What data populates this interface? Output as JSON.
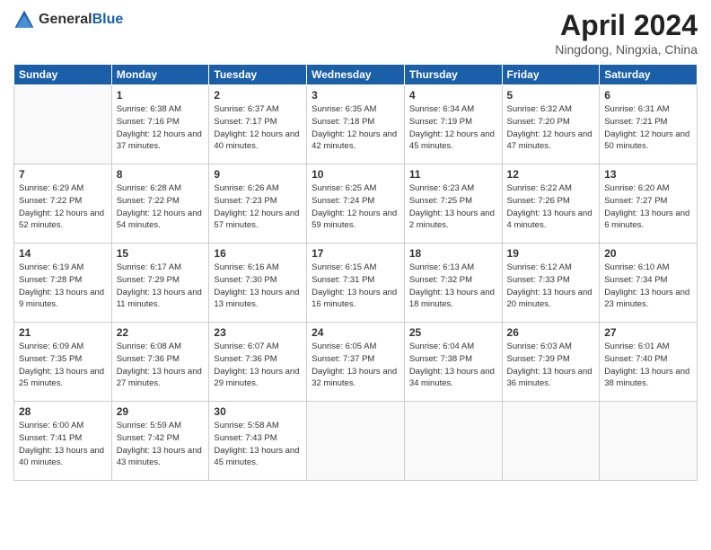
{
  "header": {
    "logo_general": "General",
    "logo_blue": "Blue",
    "title": "April 2024",
    "subtitle": "Ningdong, Ningxia, China"
  },
  "days_of_week": [
    "Sunday",
    "Monday",
    "Tuesday",
    "Wednesday",
    "Thursday",
    "Friday",
    "Saturday"
  ],
  "weeks": [
    [
      {
        "day": "",
        "info": ""
      },
      {
        "day": "1",
        "info": "Sunrise: 6:38 AM\nSunset: 7:16 PM\nDaylight: 12 hours\nand 37 minutes."
      },
      {
        "day": "2",
        "info": "Sunrise: 6:37 AM\nSunset: 7:17 PM\nDaylight: 12 hours\nand 40 minutes."
      },
      {
        "day": "3",
        "info": "Sunrise: 6:35 AM\nSunset: 7:18 PM\nDaylight: 12 hours\nand 42 minutes."
      },
      {
        "day": "4",
        "info": "Sunrise: 6:34 AM\nSunset: 7:19 PM\nDaylight: 12 hours\nand 45 minutes."
      },
      {
        "day": "5",
        "info": "Sunrise: 6:32 AM\nSunset: 7:20 PM\nDaylight: 12 hours\nand 47 minutes."
      },
      {
        "day": "6",
        "info": "Sunrise: 6:31 AM\nSunset: 7:21 PM\nDaylight: 12 hours\nand 50 minutes."
      }
    ],
    [
      {
        "day": "7",
        "info": "Sunrise: 6:29 AM\nSunset: 7:22 PM\nDaylight: 12 hours\nand 52 minutes."
      },
      {
        "day": "8",
        "info": "Sunrise: 6:28 AM\nSunset: 7:22 PM\nDaylight: 12 hours\nand 54 minutes."
      },
      {
        "day": "9",
        "info": "Sunrise: 6:26 AM\nSunset: 7:23 PM\nDaylight: 12 hours\nand 57 minutes."
      },
      {
        "day": "10",
        "info": "Sunrise: 6:25 AM\nSunset: 7:24 PM\nDaylight: 12 hours\nand 59 minutes."
      },
      {
        "day": "11",
        "info": "Sunrise: 6:23 AM\nSunset: 7:25 PM\nDaylight: 13 hours\nand 2 minutes."
      },
      {
        "day": "12",
        "info": "Sunrise: 6:22 AM\nSunset: 7:26 PM\nDaylight: 13 hours\nand 4 minutes."
      },
      {
        "day": "13",
        "info": "Sunrise: 6:20 AM\nSunset: 7:27 PM\nDaylight: 13 hours\nand 6 minutes."
      }
    ],
    [
      {
        "day": "14",
        "info": "Sunrise: 6:19 AM\nSunset: 7:28 PM\nDaylight: 13 hours\nand 9 minutes."
      },
      {
        "day": "15",
        "info": "Sunrise: 6:17 AM\nSunset: 7:29 PM\nDaylight: 13 hours\nand 11 minutes."
      },
      {
        "day": "16",
        "info": "Sunrise: 6:16 AM\nSunset: 7:30 PM\nDaylight: 13 hours\nand 13 minutes."
      },
      {
        "day": "17",
        "info": "Sunrise: 6:15 AM\nSunset: 7:31 PM\nDaylight: 13 hours\nand 16 minutes."
      },
      {
        "day": "18",
        "info": "Sunrise: 6:13 AM\nSunset: 7:32 PM\nDaylight: 13 hours\nand 18 minutes."
      },
      {
        "day": "19",
        "info": "Sunrise: 6:12 AM\nSunset: 7:33 PM\nDaylight: 13 hours\nand 20 minutes."
      },
      {
        "day": "20",
        "info": "Sunrise: 6:10 AM\nSunset: 7:34 PM\nDaylight: 13 hours\nand 23 minutes."
      }
    ],
    [
      {
        "day": "21",
        "info": "Sunrise: 6:09 AM\nSunset: 7:35 PM\nDaylight: 13 hours\nand 25 minutes."
      },
      {
        "day": "22",
        "info": "Sunrise: 6:08 AM\nSunset: 7:36 PM\nDaylight: 13 hours\nand 27 minutes."
      },
      {
        "day": "23",
        "info": "Sunrise: 6:07 AM\nSunset: 7:36 PM\nDaylight: 13 hours\nand 29 minutes."
      },
      {
        "day": "24",
        "info": "Sunrise: 6:05 AM\nSunset: 7:37 PM\nDaylight: 13 hours\nand 32 minutes."
      },
      {
        "day": "25",
        "info": "Sunrise: 6:04 AM\nSunset: 7:38 PM\nDaylight: 13 hours\nand 34 minutes."
      },
      {
        "day": "26",
        "info": "Sunrise: 6:03 AM\nSunset: 7:39 PM\nDaylight: 13 hours\nand 36 minutes."
      },
      {
        "day": "27",
        "info": "Sunrise: 6:01 AM\nSunset: 7:40 PM\nDaylight: 13 hours\nand 38 minutes."
      }
    ],
    [
      {
        "day": "28",
        "info": "Sunrise: 6:00 AM\nSunset: 7:41 PM\nDaylight: 13 hours\nand 40 minutes."
      },
      {
        "day": "29",
        "info": "Sunrise: 5:59 AM\nSunset: 7:42 PM\nDaylight: 13 hours\nand 43 minutes."
      },
      {
        "day": "30",
        "info": "Sunrise: 5:58 AM\nSunset: 7:43 PM\nDaylight: 13 hours\nand 45 minutes."
      },
      {
        "day": "",
        "info": ""
      },
      {
        "day": "",
        "info": ""
      },
      {
        "day": "",
        "info": ""
      },
      {
        "day": "",
        "info": ""
      }
    ]
  ]
}
